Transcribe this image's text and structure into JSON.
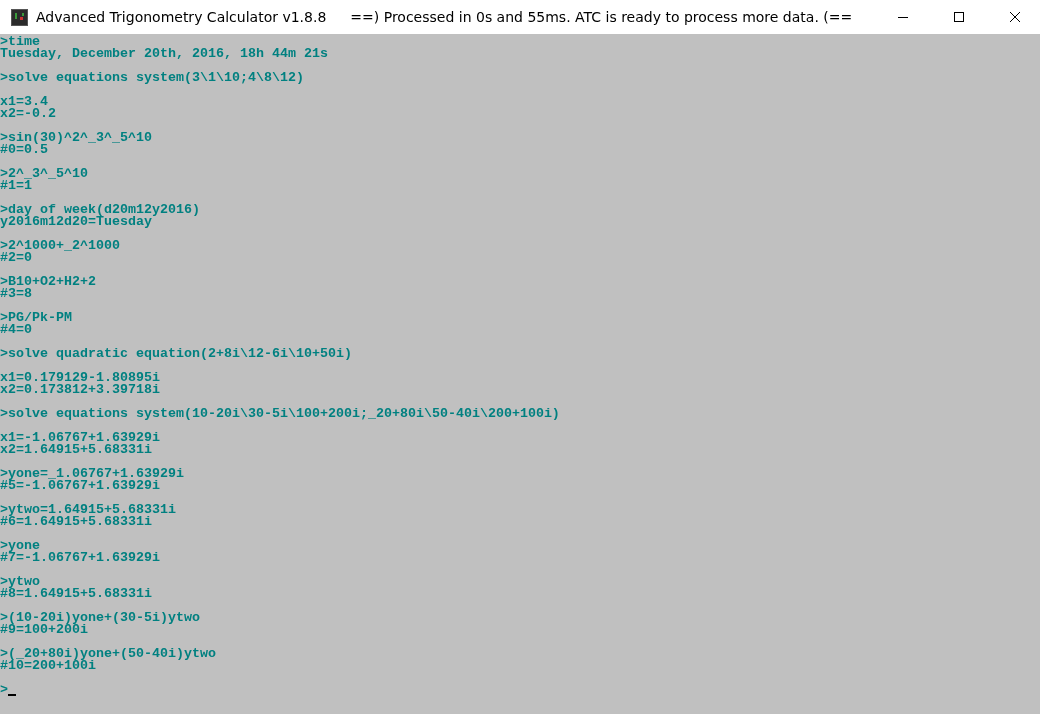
{
  "window": {
    "title": "Advanced Trigonometry Calculator v1.8.8",
    "status": "==) Processed in 0s and 55ms. ATC is ready to process more data. (=="
  },
  "console": {
    "blocks": [
      [
        ">time",
        "Tuesday, December 20th, 2016, 18h 44m 21s"
      ],
      [
        ">solve equations system(3\\1\\10;4\\8\\12)"
      ],
      [
        "x1=3.4",
        "x2=-0.2"
      ],
      [
        ">sin(30)^2^_3^_5^10",
        "#0=0.5"
      ],
      [
        ">2^_3^_5^10",
        "#1=1"
      ],
      [
        ">day of week(d20m12y2016)",
        "y2016m12d20=Tuesday"
      ],
      [
        ">2^1000+_2^1000",
        "#2=0"
      ],
      [
        ">B10+O2+H2+2",
        "#3=8"
      ],
      [
        ">PG/Pk-PM",
        "#4=0"
      ],
      [
        ">solve quadratic equation(2+8i\\12-6i\\10+50i)"
      ],
      [
        "x1=0.179129-1.80895i",
        "x2=0.173812+3.39718i"
      ],
      [
        ">solve equations system(10-20i\\30-5i\\100+200i;_20+80i\\50-40i\\200+100i)"
      ],
      [
        "x1=-1.06767+1.63929i",
        "x2=1.64915+5.68331i"
      ],
      [
        ">yone=_1.06767+1.63929i",
        "#5=-1.06767+1.63929i"
      ],
      [
        ">ytwo=1.64915+5.68331i",
        "#6=1.64915+5.68331i"
      ],
      [
        ">yone",
        "#7=-1.06767+1.63929i"
      ],
      [
        ">ytwo",
        "#8=1.64915+5.68331i"
      ],
      [
        ">(10-20i)yone+(30-5i)ytwo",
        "#9=100+200i"
      ],
      [
        ">(_20+80i)yone+(50-40i)ytwo",
        "#10=200+100i"
      ]
    ],
    "prompt": ">"
  }
}
